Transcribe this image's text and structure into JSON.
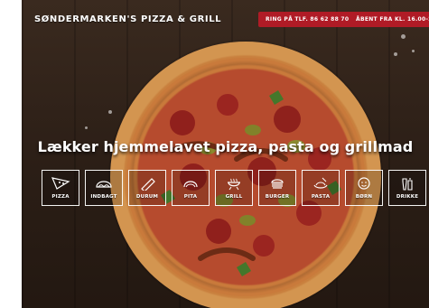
{
  "header": {
    "logo_text": "SØNDERMARKEN'S PIZZA & GRILL",
    "call_button": "RING PÅ TLF. 86 62 88 70",
    "hours_badge": "ÅBENT FRA KL. 16.00-22.00"
  },
  "hero": {
    "headline": "Lækker hjemmelavet pizza, pasta og grillmad"
  },
  "categories": [
    {
      "label": "PIZZA",
      "icon": "pizza-slice-icon"
    },
    {
      "label": "INDBAGT",
      "icon": "calzone-icon"
    },
    {
      "label": "DURUM",
      "icon": "wrap-icon"
    },
    {
      "label": "PITA",
      "icon": "pita-icon"
    },
    {
      "label": "GRILL",
      "icon": "grill-icon"
    },
    {
      "label": "BURGER",
      "icon": "burger-icon"
    },
    {
      "label": "PASTA",
      "icon": "pasta-icon"
    },
    {
      "label": "BØRN",
      "icon": "kids-face-icon"
    },
    {
      "label": "DRIKKE",
      "icon": "drinks-icon"
    }
  ],
  "colors": {
    "accent": "#b01b26",
    "text_on_dark": "#ffffff"
  }
}
